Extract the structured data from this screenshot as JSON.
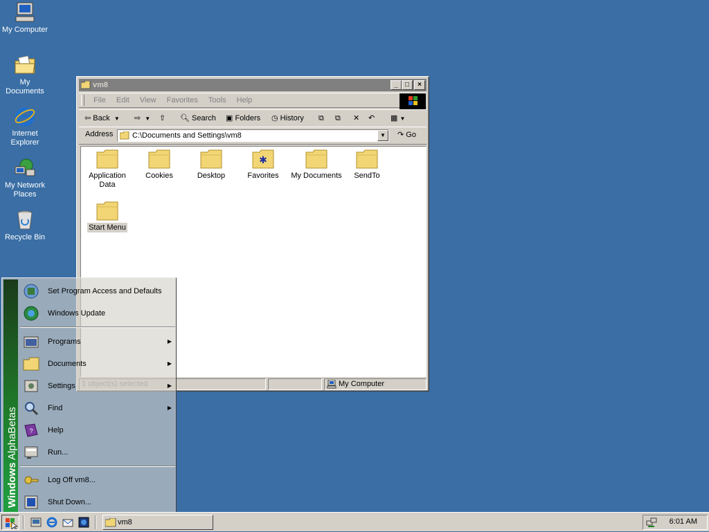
{
  "desktop": {
    "icons": [
      {
        "label": "My Computer"
      },
      {
        "label": "My Documents"
      },
      {
        "label": "Internet Explorer"
      },
      {
        "label": "My Network Places"
      },
      {
        "label": "Recycle Bin"
      }
    ]
  },
  "window": {
    "title": "vm8",
    "menu": [
      "File",
      "Edit",
      "View",
      "Favorites",
      "Tools",
      "Help"
    ],
    "toolbar": {
      "back": "Back",
      "search": "Search",
      "folders": "Folders",
      "history": "History"
    },
    "address": {
      "label": "Address",
      "value": "C:\\Documents and Settings\\vm8",
      "go": "Go"
    },
    "folders": [
      {
        "label": "Application Data"
      },
      {
        "label": "Cookies"
      },
      {
        "label": "Desktop"
      },
      {
        "label": "Favorites"
      },
      {
        "label": "My Documents"
      },
      {
        "label": "SendTo"
      },
      {
        "label": "Start Menu",
        "selected": true
      }
    ],
    "status": {
      "count": "1 object(s) selected",
      "zone": "My Computer"
    }
  },
  "start_menu": {
    "banner_bold": "Windows",
    "banner_light": "AlphaBetas",
    "top_items": [
      {
        "label": "Set Program Access and Defaults"
      },
      {
        "label": "Windows Update"
      }
    ],
    "items": [
      {
        "label": "Programs",
        "submenu": true
      },
      {
        "label": "Documents",
        "submenu": true
      },
      {
        "label": "Settings",
        "submenu": true
      },
      {
        "label": "Find",
        "submenu": true
      },
      {
        "label": "Help",
        "submenu": false
      },
      {
        "label": "Run...",
        "submenu": false
      }
    ],
    "bottom_items": [
      {
        "label": "Log Off vm8..."
      },
      {
        "label": "Shut Down..."
      }
    ]
  },
  "taskbar": {
    "task": "vm8",
    "clock": "6:01 AM"
  },
  "colors": {
    "desktop": "#3a6ea5",
    "face": "#d4d0c8",
    "title_inactive": "#808080",
    "banner": "#1f7a2a"
  }
}
